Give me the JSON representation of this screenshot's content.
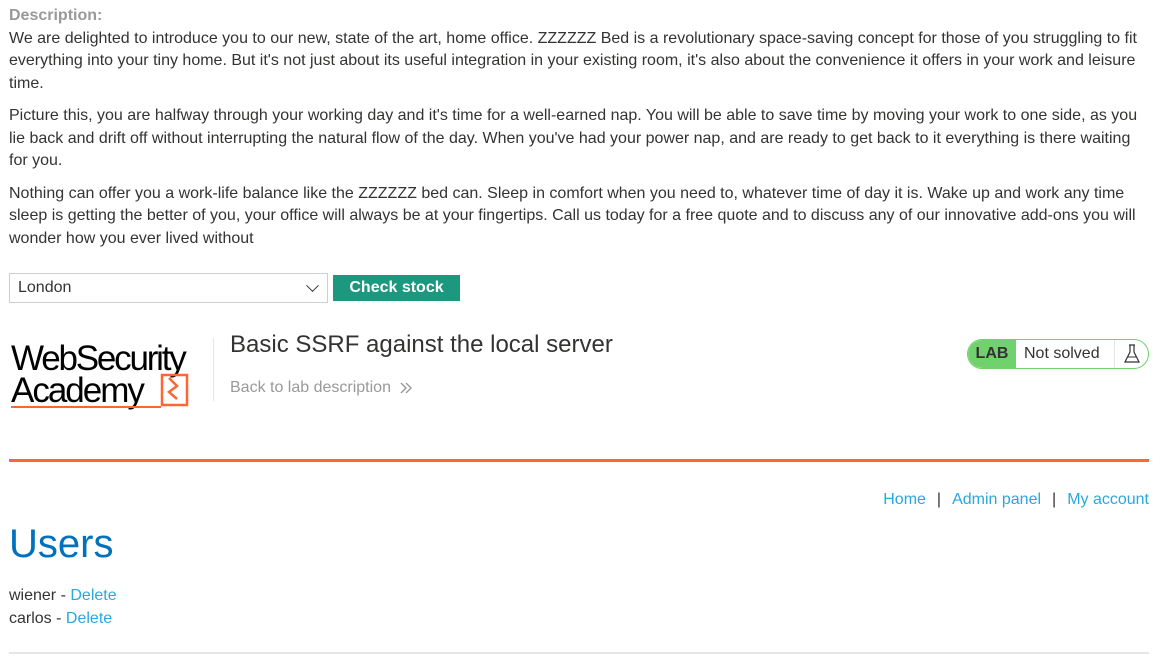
{
  "product": {
    "description_label": "Description:",
    "paragraphs": [
      "We are delighted to introduce you to our new, state of the art, home office. ZZZZZZ Bed is a revolutionary space-saving concept for those of you struggling to fit everything into your tiny home. But it's not just about its useful integration in your existing room, it's also about the convenience it offers in your work and leisure time.",
      "Picture this, you are halfway through your working day and it's time for a well-earned nap. You will be able to save time by moving your work to one side, as you lie back and drift off without interrupting the natural flow of the day. When you've had your power nap, and are ready to get back to it everything is there waiting for you.",
      "Nothing can offer you a work-life balance like the ZZZZZZ bed can. Sleep in comfort when you need to, whatever time of day it is. Wake up and work any time sleep is getting the better of you, your office will always be at your fingertips. Call us today for a free quote and to discuss any of our innovative add-ons you will wonder how you ever lived without"
    ]
  },
  "stock_form": {
    "selected_store": "London",
    "check_button_label": "Check stock"
  },
  "lab_header": {
    "logo_line1": "WebSecurity",
    "logo_line2": "Academy",
    "title": "Basic SSRF against the local server",
    "back_link": "Back to lab description",
    "badge": "LAB",
    "status": "Not solved",
    "status_icon": "flask-icon"
  },
  "nav": {
    "home": "Home",
    "separator": "|",
    "admin_panel": "Admin panel",
    "my_account": "My account"
  },
  "admin": {
    "title": "Users",
    "users": [
      {
        "name": "wiener",
        "dash": " - ",
        "action": "Delete"
      },
      {
        "name": "carlos",
        "dash": " - ",
        "action": "Delete"
      }
    ]
  },
  "colors": {
    "accent_orange": "#ff6633",
    "link_blue": "#29a8e0",
    "heading_blue": "#0071bc",
    "button_green": "#1c987e",
    "lab_green": "#70d16d"
  }
}
